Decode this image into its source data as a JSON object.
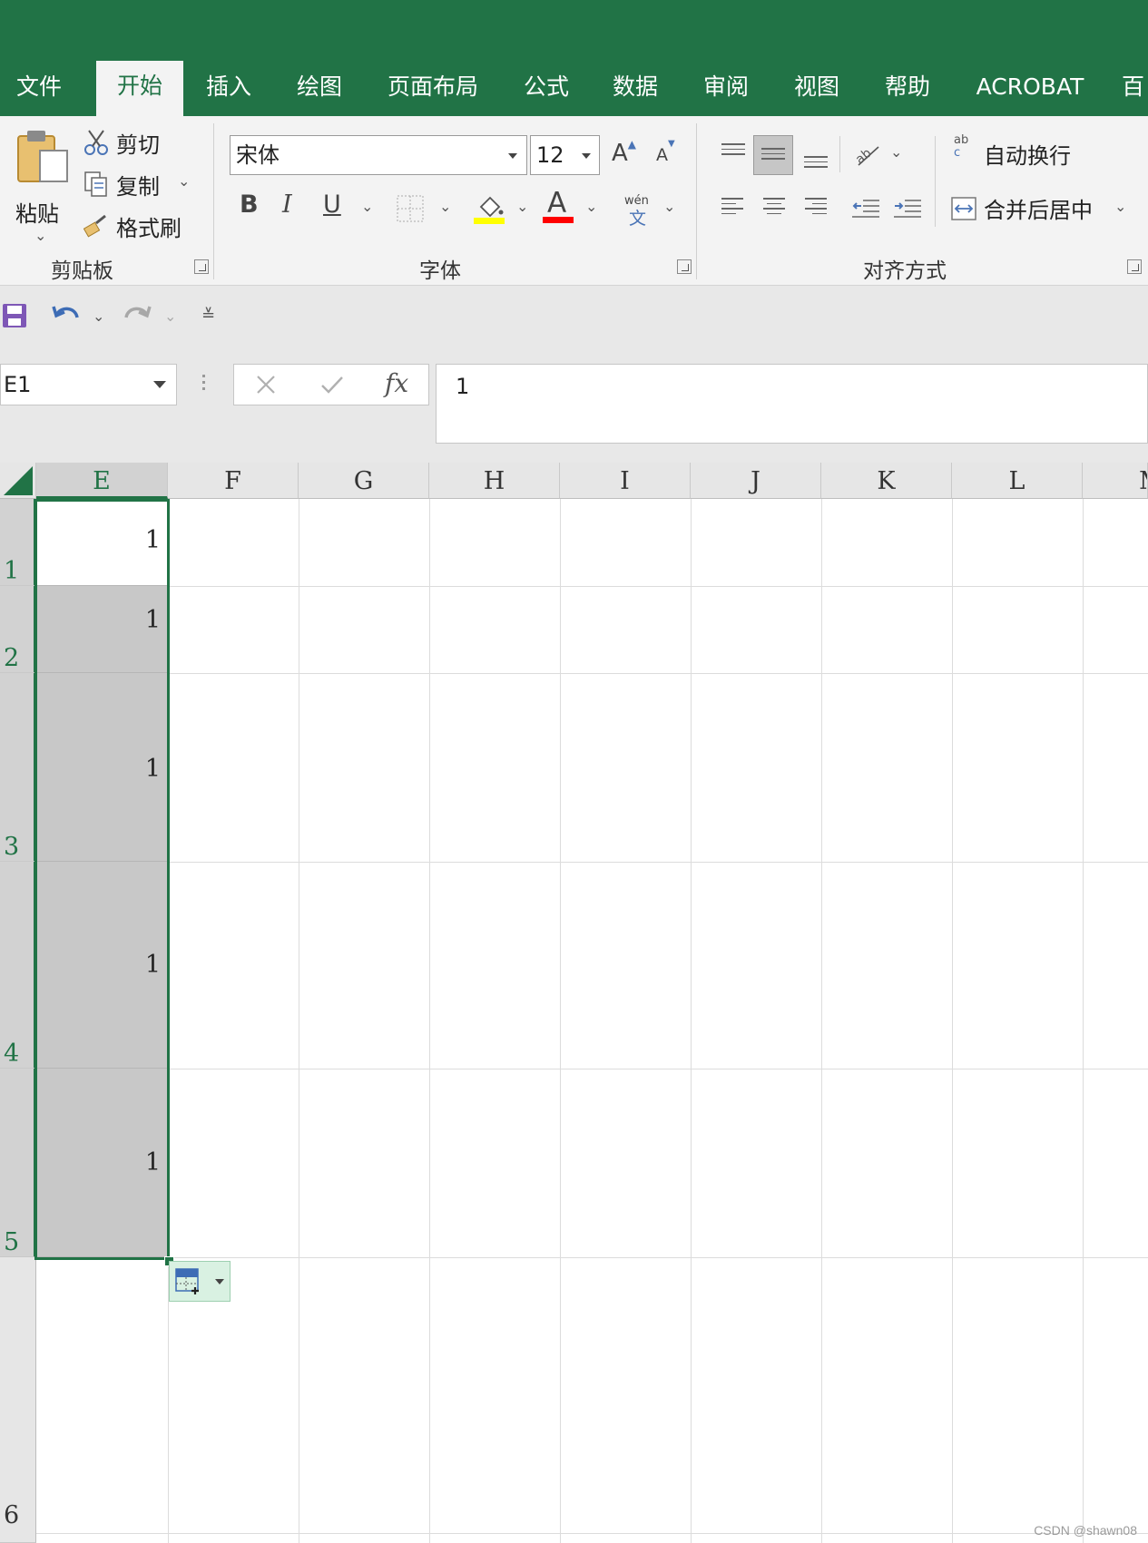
{
  "tabs": [
    "文件",
    "开始",
    "插入",
    "绘图",
    "页面布局",
    "公式",
    "数据",
    "审阅",
    "视图",
    "帮助",
    "ACROBAT",
    "百"
  ],
  "active_tab": "开始",
  "clipboard": {
    "paste_label": "粘贴",
    "cut_label": "剪切",
    "copy_label": "复制",
    "format_painter_label": "格式刷",
    "group_label": "剪贴板"
  },
  "font": {
    "font_name": "宋体",
    "font_size": "12",
    "bold": "B",
    "italic": "I",
    "underline": "U",
    "grow_font": "A",
    "shrink_font": "A",
    "font_color_glyph": "A",
    "phonetic_top": "wén",
    "phonetic_bottom": "文",
    "group_label": "字体",
    "fill_color": "#ffff00",
    "font_color": "#ff0000"
  },
  "alignment": {
    "wrap_text_label": "自动换行",
    "merge_center_label": "合并后居中",
    "group_label": "对齐方式",
    "wrap_icon_top": "ab",
    "wrap_icon_bottom": "c"
  },
  "formula_bar": {
    "name_box": "E1",
    "fx": "fx",
    "value": "1"
  },
  "sheet": {
    "columns": [
      "E",
      "F",
      "G",
      "H",
      "I",
      "J",
      "K",
      "L",
      "M"
    ],
    "selected_column": "E",
    "rows": [
      "1",
      "2",
      "3",
      "4",
      "5",
      "6"
    ],
    "cells_E": [
      "1",
      "1",
      "1",
      "1",
      "1"
    ]
  },
  "watermark": "CSDN @shawn08",
  "colors": {
    "brand": "#217346",
    "selection": "#c8c8c8"
  }
}
